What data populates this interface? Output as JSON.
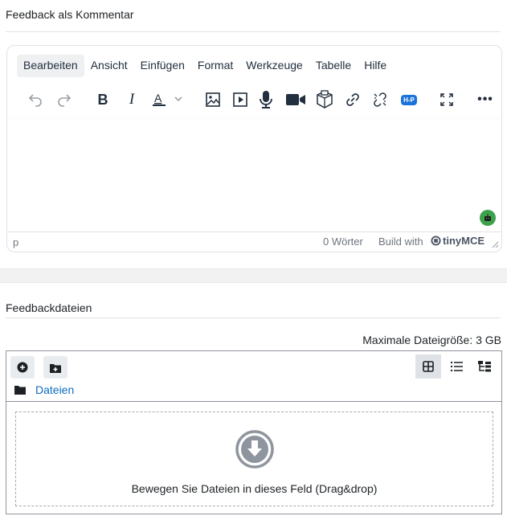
{
  "feedback_comment": {
    "label": "Feedback als Kommentar",
    "menubar": [
      "Bearbeiten",
      "Ansicht",
      "Einfügen",
      "Format",
      "Werkzeuge",
      "Tabelle",
      "Hilfe"
    ],
    "toolbar_icons": [
      "undo-icon",
      "redo-icon",
      "bold-icon",
      "italic-icon",
      "text-color-icon",
      "image-icon",
      "media-icon",
      "microphone-icon",
      "video-camera-icon",
      "h5p-content-icon",
      "link-icon",
      "unlink-icon",
      "h5p-icon",
      "fullscreen-icon",
      "more-icon"
    ],
    "h5p_badge": "H-P",
    "status_path": "p",
    "word_count": "0 Wörter",
    "build_with": "Build with",
    "brand": "tinyMCE"
  },
  "feedback_files": {
    "label": "Feedbackdateien",
    "max_size": "Maximale Dateigröße: 3 GB",
    "folder": "Dateien",
    "dropzone_text": "Bewegen Sie Dateien in dieses Feld (Drag&drop)"
  },
  "colors": {
    "accent_link": "#0f6cbf",
    "tiny_bg": "#ffffff",
    "h5p_blue": "#1a73d9",
    "robot_green": "#3ea14c"
  }
}
